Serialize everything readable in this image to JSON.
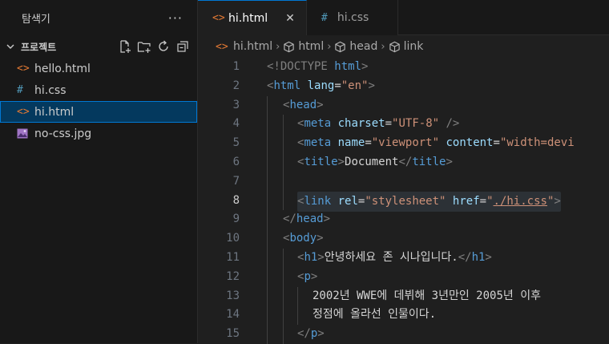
{
  "sidebar": {
    "title": "탐색기",
    "more": "···",
    "section": "프로젝트",
    "files": [
      {
        "name": "hello.html",
        "icon": "<>",
        "type": "html"
      },
      {
        "name": "hi.css",
        "icon": "#",
        "type": "css"
      },
      {
        "name": "hi.html",
        "icon": "<>",
        "type": "html",
        "selected": true
      },
      {
        "name": "no-css.jpg",
        "icon": "img",
        "type": "image"
      }
    ]
  },
  "tabs": [
    {
      "label": "hi.html",
      "icon": "<>",
      "active": true,
      "close": "✕"
    },
    {
      "label": "hi.css",
      "icon": "#",
      "active": false
    }
  ],
  "breadcrumb": {
    "file_icon": "<>",
    "items": [
      "hi.html",
      "html",
      "head",
      "link"
    ]
  },
  "code": {
    "lines": [
      {
        "n": "1",
        "indent": 0
      },
      {
        "n": "2",
        "indent": 0
      },
      {
        "n": "3",
        "indent": 1
      },
      {
        "n": "4",
        "indent": 2
      },
      {
        "n": "5",
        "indent": 2
      },
      {
        "n": "6",
        "indent": 2
      },
      {
        "n": "7",
        "indent": 2
      },
      {
        "n": "8",
        "indent": 2
      },
      {
        "n": "9",
        "indent": 1
      },
      {
        "n": "10",
        "indent": 1
      },
      {
        "n": "11",
        "indent": 2
      },
      {
        "n": "12",
        "indent": 2
      },
      {
        "n": "13",
        "indent": 3
      },
      {
        "n": "14",
        "indent": 3
      },
      {
        "n": "15",
        "indent": 2
      }
    ],
    "l1": [
      "<!DOCTYPE ",
      "html",
      ">"
    ],
    "l2": [
      "<",
      "html",
      " ",
      "lang",
      "=",
      "\"en\"",
      ">"
    ],
    "l3": [
      "<",
      "head",
      ">"
    ],
    "l4": [
      "<",
      "meta",
      " ",
      "charset",
      "=",
      "\"UTF-8\"",
      " />"
    ],
    "l5": [
      "<",
      "meta",
      " ",
      "name",
      "=",
      "\"viewport\"",
      " ",
      "content",
      "=",
      "\"width=devi"
    ],
    "l6": [
      "<",
      "title",
      ">",
      "Document",
      "</",
      "title",
      ">"
    ],
    "l8": [
      "<",
      "link",
      " ",
      "rel",
      "=",
      "\"stylesheet\"",
      " ",
      "href",
      "=",
      "\"",
      "./hi.css",
      "\"",
      ">"
    ],
    "l9": [
      "</",
      "head",
      ">"
    ],
    "l10": [
      "<",
      "body",
      ">"
    ],
    "l11": [
      "<",
      "h1",
      ">",
      "안녕하세요 존 시나입니다.",
      "</",
      "h1",
      ">"
    ],
    "l12": [
      "<",
      "p",
      ">"
    ],
    "l13": "2002년 WWE에 데뷔해 3년만인 2005년 이후",
    "l14": "정점에 올라선 인물이다.",
    "l15": [
      "</",
      "p",
      ">"
    ]
  },
  "colors": {
    "accent": "#0078d4",
    "selection": "#04395e",
    "tag": "#569cd6",
    "attribute": "#9cdcfe",
    "string": "#ce9178"
  }
}
